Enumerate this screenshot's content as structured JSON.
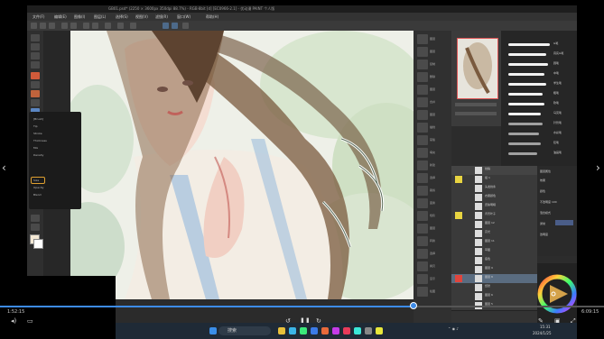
{
  "window": {
    "title": "GB01.psd* (2250 × 3600px 350dpi 88.7%) - RGB·8bit [d] [EC0966-2.1] - 优动漫 PAINT 个人版"
  },
  "menu": {
    "items": [
      "文件(F)",
      "编辑(E)",
      "图像(I)",
      "图层(L)",
      "选择(S)",
      "视图(V)",
      "滤镜(R)",
      "窗口(W)",
      "帮助(H)"
    ]
  },
  "toolprops": {
    "rows": [
      "[Brush]",
      "Tip",
      "Stroke",
      "Thickness",
      "Mix",
      "Density",
      "",
      "Size",
      "Opacity",
      "Blend"
    ]
  },
  "side_icons": {
    "labels": [
      "图层",
      "图层",
      "复制",
      "删除",
      "图层",
      "合并",
      "图层",
      "描线",
      "蒙版",
      "填充",
      "新建",
      "选择",
      "裁剪",
      "变换",
      "色阶",
      "图层",
      "转换",
      "选择",
      "拷贝",
      "显示",
      "绘图"
    ]
  },
  "brushes": {
    "names": [
      "G笔",
      "真实G笔",
      "圆笔",
      "中笔",
      "学生笔",
      "粗笔",
      "软笔",
      "马克笔",
      "针管笔",
      "水彩笔",
      "铅笔",
      "油画笔",
      "钢笔",
      "喷枪",
      "特效笔"
    ]
  },
  "layers": {
    "names": [
      "线稿",
      "组 1",
      "头发线条",
      "衣服颜色",
      "皮肤明暗",
      "背景叶子",
      "图层 12",
      "高光",
      "图层 11",
      "草图",
      "底色",
      "图层 9",
      "图层 8",
      "纸张",
      "图层 6",
      "图层 5"
    ]
  },
  "props": {
    "rows": [
      "图层属性",
      "效果",
      "颜色",
      "不透明度 100",
      "混合模式",
      "通常",
      "透明度"
    ]
  },
  "video": {
    "current_time": "1:52:15",
    "total_time": "6:09:15",
    "progress": 0.685
  },
  "taskbar": {
    "search": "搜索",
    "clock_time": "15:31",
    "clock_date": "2024/1/25"
  },
  "icons": {
    "prev": "chevron-left-icon",
    "next": "chevron-right-icon",
    "volume": "volume-icon",
    "caption": "caption-icon"
  },
  "colors": {
    "accent": "#3d8be8",
    "highlight_layer": "#e8d441",
    "active_layer": "#e0453d"
  }
}
